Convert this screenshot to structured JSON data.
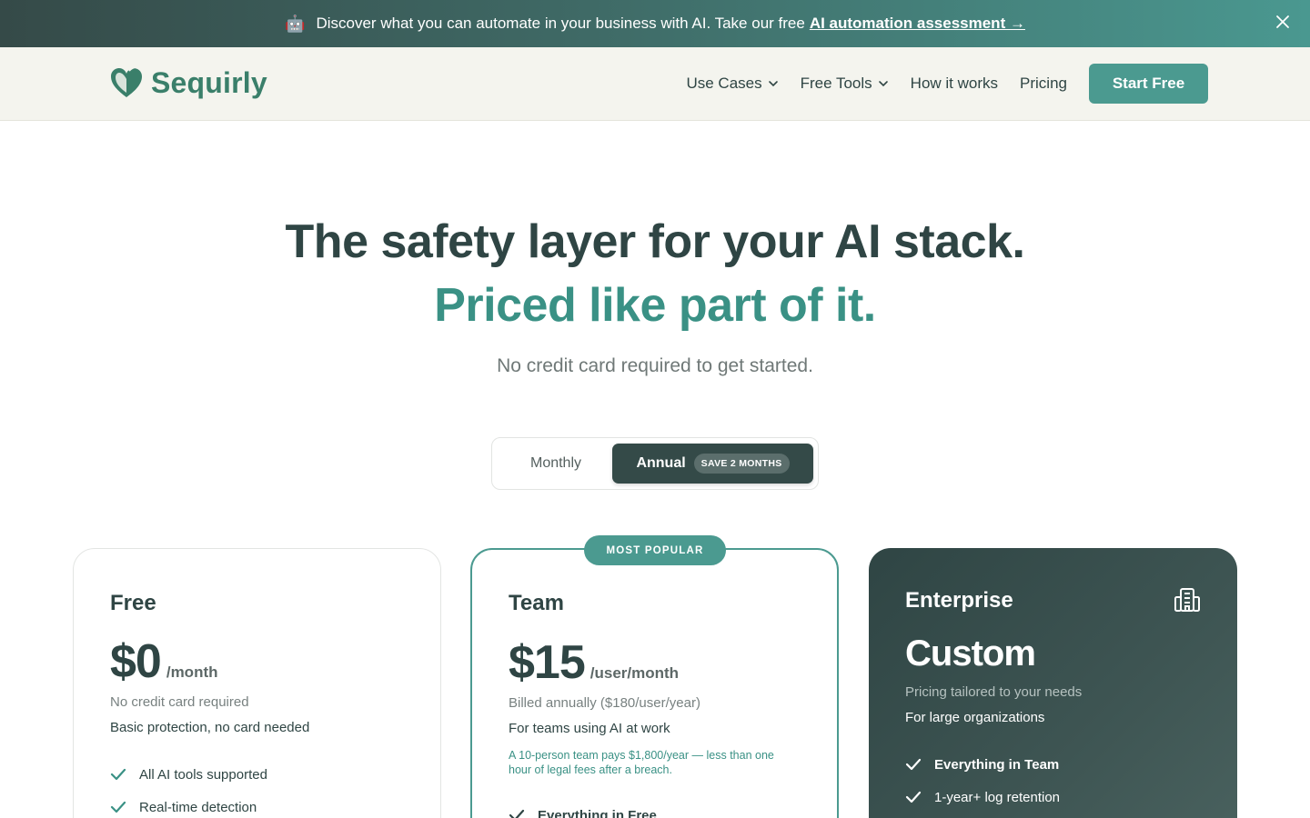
{
  "banner": {
    "icon": "robot-icon",
    "text": "Discover what you can automate in your business with AI. Take our free",
    "link": "AI automation assessment →"
  },
  "nav": {
    "logo_text": "Sequirly",
    "items": [
      "Use Cases",
      "Free Tools",
      "How it works",
      "Pricing"
    ],
    "cta": "Start Free"
  },
  "hero": {
    "title": "The safety layer for your AI stack.",
    "subtitle": "Priced like part of it.",
    "note": "No credit card required to get started."
  },
  "billing_toggle": {
    "monthly": "Monthly",
    "annual": "Annual",
    "save_badge": "SAVE 2 MONTHS",
    "selected": "Annual"
  },
  "plans": {
    "free": {
      "name": "Free",
      "price": "$0",
      "per": "/month",
      "line1": "No credit card required",
      "line2": "Basic protection, no card needed",
      "features": [
        "All AI tools supported",
        "Real-time detection"
      ]
    },
    "team": {
      "badge": "MOST POPULAR",
      "name": "Team",
      "price": "$15",
      "per": "/user/month",
      "line1": "Billed annually ($180/user/year)",
      "line2": "For teams using AI at work",
      "note": "A 10-person team pays $1,800/year — less than one hour of legal fees after a breach.",
      "features": [
        "Everything in Free"
      ]
    },
    "enterprise": {
      "name": "Enterprise",
      "price": "Custom",
      "line1": "Pricing tailored to your needs",
      "line2": "For large organizations",
      "features": [
        "Everything in Team",
        "1-year+ log retention"
      ]
    }
  },
  "colors": {
    "brand": "#4b9a90",
    "dark": "#2f4544",
    "accent_text": "#3a9185"
  }
}
